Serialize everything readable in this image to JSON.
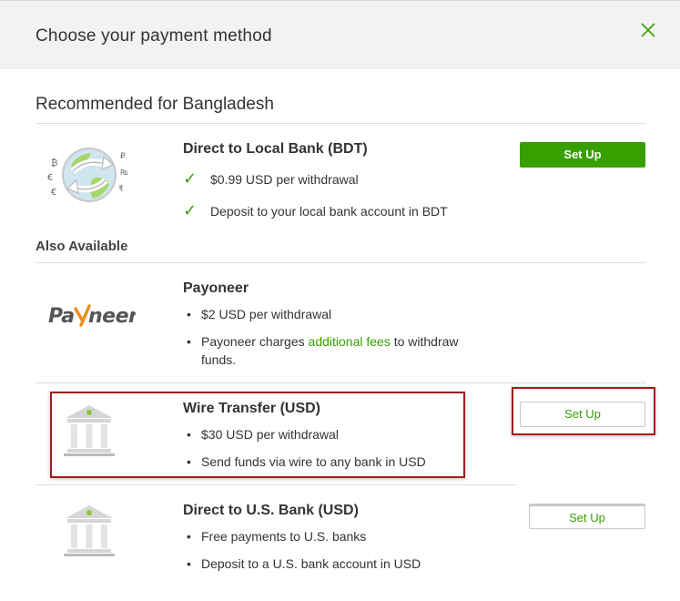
{
  "modal": {
    "title": "Choose your payment method"
  },
  "recommended": {
    "heading": "Recommended for Bangladesh",
    "method": {
      "title": "Direct to Local Bank (BDT)",
      "features": [
        "$0.99 USD per withdrawal",
        "Deposit to your local bank account in BDT"
      ],
      "button": "Set Up",
      "icon": "currency-globe-icon"
    }
  },
  "also_available": {
    "heading": "Also Available",
    "methods": [
      {
        "title": "Payoneer",
        "logo": "Payoneer",
        "features": [
          "$2 USD per withdrawal"
        ],
        "fee_note": {
          "before": "Payoneer charges ",
          "link": "additional fees",
          "after": " to withdraw funds."
        }
      },
      {
        "title": "Wire Transfer (USD)",
        "features": [
          "$30 USD per withdrawal",
          "Send funds via wire to any bank in USD"
        ],
        "button": "Set Up",
        "icon": "bank-icon"
      },
      {
        "title": "Direct to U.S. Bank (USD)",
        "features": [
          "Free payments to U.S. banks",
          "Deposit to a U.S. bank account in USD"
        ],
        "button": "Set Up",
        "icon": "bank-icon"
      }
    ]
  },
  "colors": {
    "accent": "#37a000",
    "highlight": "#a11b1b",
    "header_bg": "#f2f2f2"
  },
  "glyphs": {
    "check": "✓",
    "bullet": "•"
  }
}
